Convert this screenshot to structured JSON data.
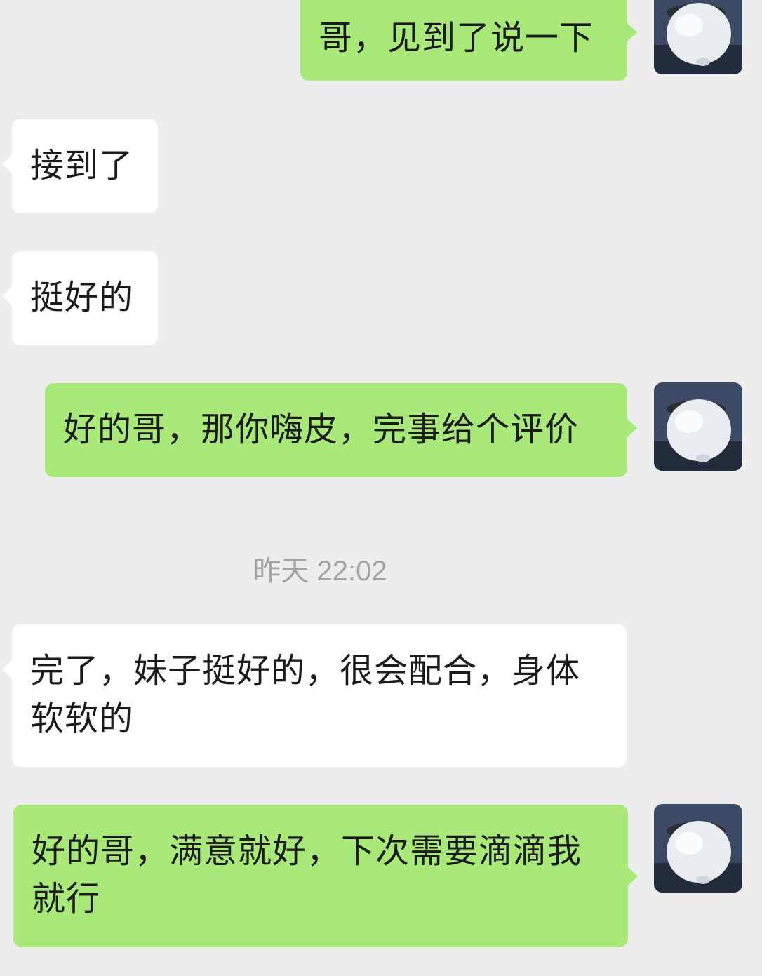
{
  "chat": {
    "messages": [
      {
        "direction": "out",
        "text": "哥，见到了说一下"
      },
      {
        "direction": "in",
        "text": "接到了"
      },
      {
        "direction": "in",
        "text": "挺好的"
      },
      {
        "direction": "out",
        "text": "好的哥，那你嗨皮，完事给个评价"
      },
      {
        "direction": "in",
        "text": "完了，妹子挺好的，很会配合，身体软软的"
      },
      {
        "direction": "out",
        "text": "好的哥，满意就好，下次需要滴滴我就行"
      }
    ],
    "timestamp": "昨天 22:02"
  },
  "colors": {
    "background": "#ededed",
    "bubble_out": "#a9e97a",
    "bubble_in": "#ffffff",
    "timestamp": "#a3a3a3",
    "text": "#1b1b1b"
  },
  "avatar": {
    "icon": "white-penguin-avatar-icon"
  }
}
